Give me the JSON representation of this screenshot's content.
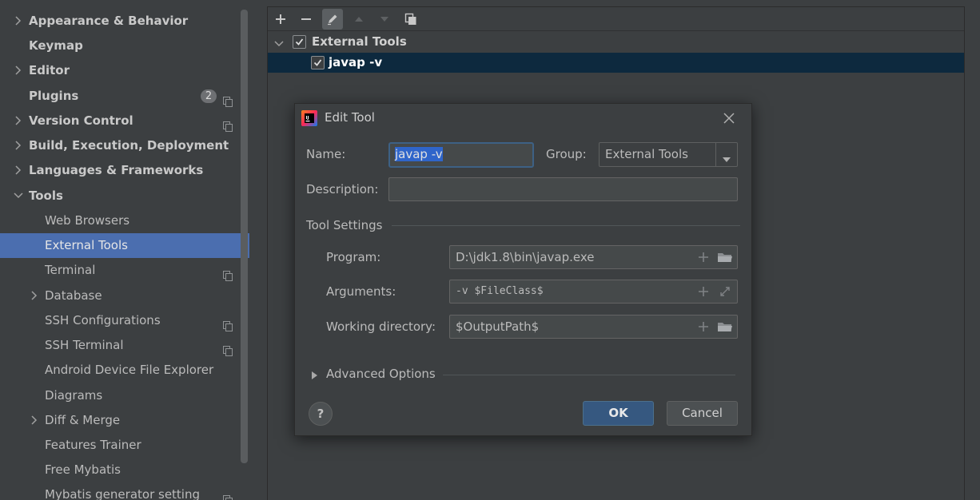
{
  "sidebar": {
    "items": [
      {
        "label": "Appearance & Behavior"
      },
      {
        "label": "Keymap"
      },
      {
        "label": "Editor"
      },
      {
        "label": "Plugins",
        "badge": "2"
      },
      {
        "label": "Version Control"
      },
      {
        "label": "Build, Execution, Deployment"
      },
      {
        "label": "Languages & Frameworks"
      },
      {
        "label": "Tools"
      },
      {
        "label": "Web Browsers"
      },
      {
        "label": "External Tools"
      },
      {
        "label": "Terminal"
      },
      {
        "label": "Database"
      },
      {
        "label": "SSH Configurations"
      },
      {
        "label": "SSH Terminal"
      },
      {
        "label": "Android Device File Explorer"
      },
      {
        "label": "Diagrams"
      },
      {
        "label": "Diff & Merge"
      },
      {
        "label": "Features Trainer"
      },
      {
        "label": "Free Mybatis"
      },
      {
        "label": "Mybatis generator setting"
      }
    ],
    "selected": "External Tools"
  },
  "tree": {
    "group_label": "External Tools",
    "tool_label": "javap -v"
  },
  "dialog": {
    "title": "Edit Tool",
    "name_label": "Name:",
    "name_value": "javap -v",
    "group_label": "Group:",
    "group_value": "External Tools",
    "description_label": "Description:",
    "description_value": "",
    "tool_settings_label": "Tool Settings",
    "program_label": "Program:",
    "program_value": "D:\\jdk1.8\\bin\\javap.exe",
    "arguments_label": "Arguments:",
    "arguments_value": "-v $FileClass$",
    "workdir_label": "Working directory:",
    "workdir_value": "$OutputPath$",
    "advanced_label": "Advanced Options",
    "help_glyph": "?",
    "ok_label": "OK",
    "cancel_label": "Cancel"
  },
  "icons": {
    "toolbar": [
      "add-icon",
      "remove-icon",
      "edit-icon",
      "move-up-icon",
      "move-down-icon",
      "copy-icon"
    ],
    "app_icon": "intellij-icon",
    "close_icon": "close-icon"
  },
  "colors": {
    "background": "#3c3f41",
    "selection": "#4b6eaf",
    "tree_selection": "#0d293e",
    "primary_button": "#365880",
    "focus_border": "#3d6185"
  }
}
